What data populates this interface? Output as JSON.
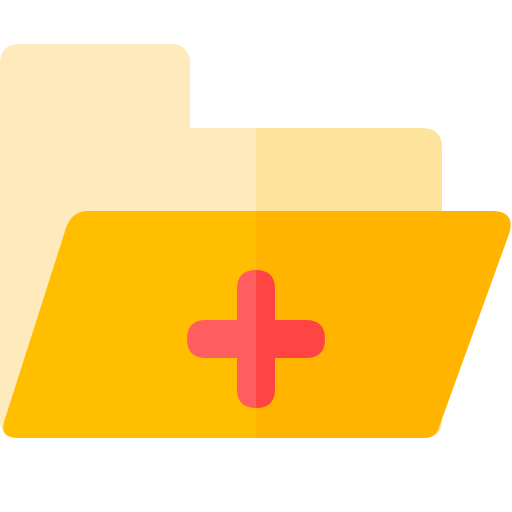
{
  "icon": {
    "name": "new-folder-icon",
    "parts": {
      "folder_back": "folder-back-icon",
      "folder_front": "folder-front-icon",
      "plus": "plus-icon"
    }
  },
  "colors": {
    "back_light": "#FEEABD",
    "back_dark": "#FEE39C",
    "front_light": "#FFBE00",
    "front_dark": "#FFB400",
    "plus_light": "#FF5E5E",
    "plus_dark": "#FF4444"
  }
}
